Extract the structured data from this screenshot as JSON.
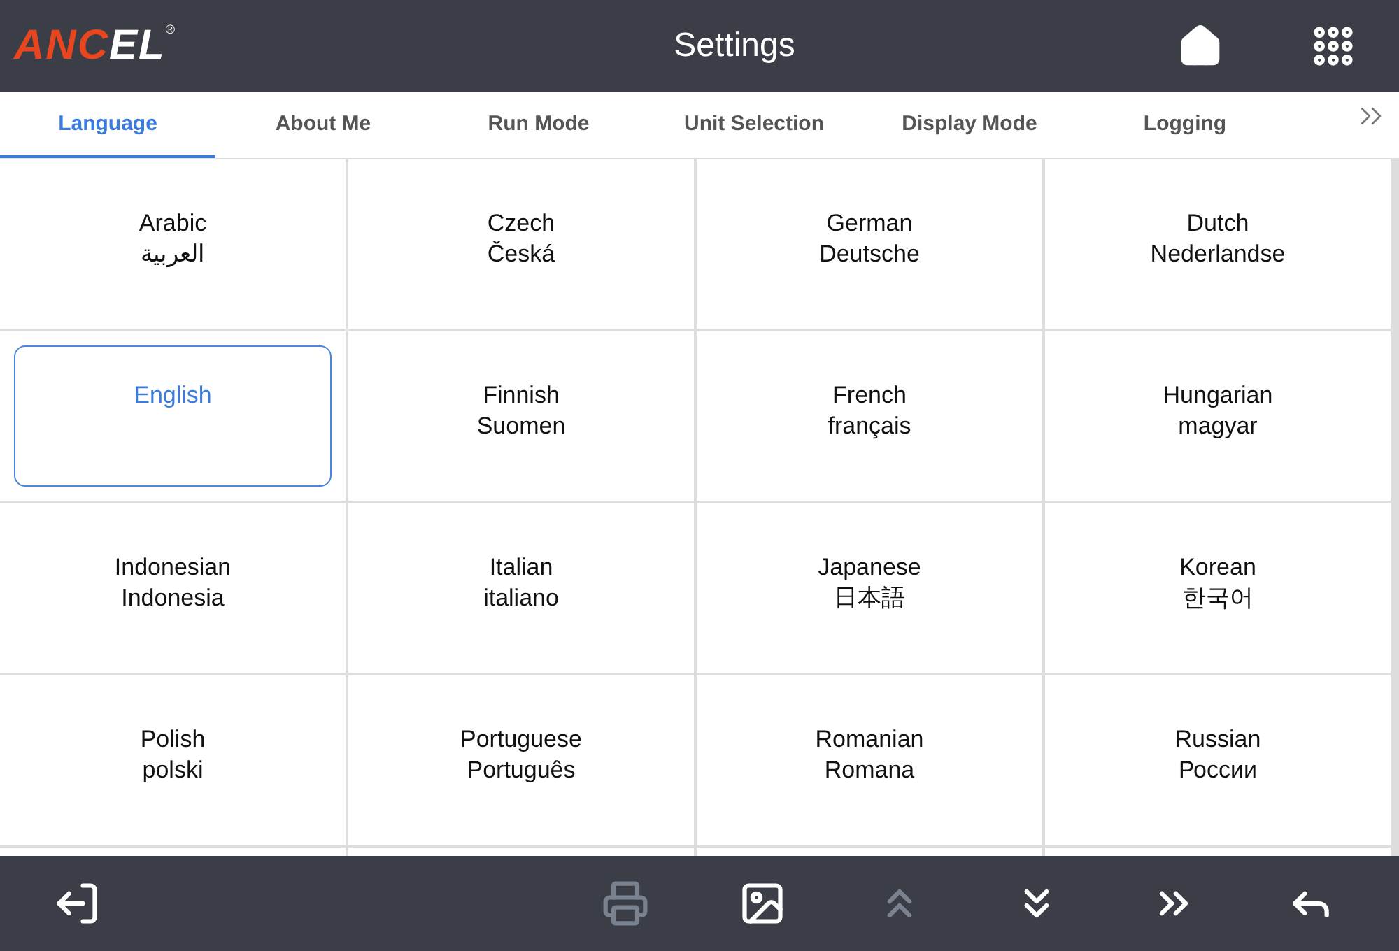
{
  "header": {
    "logo": {
      "primary": "ANC",
      "secondary": "EL",
      "mark": "®"
    },
    "title": "Settings"
  },
  "tabs": [
    {
      "label": "Language",
      "selected": true
    },
    {
      "label": "About Me",
      "selected": false
    },
    {
      "label": "Run Mode",
      "selected": false
    },
    {
      "label": "Unit Selection",
      "selected": false
    },
    {
      "label": "Display Mode",
      "selected": false
    },
    {
      "label": "Logging",
      "selected": false
    }
  ],
  "languages": [
    {
      "name": "Arabic",
      "native": "العربية",
      "selected": false
    },
    {
      "name": "Czech",
      "native": "Česká",
      "selected": false
    },
    {
      "name": "German",
      "native": "Deutsche",
      "selected": false
    },
    {
      "name": "Dutch",
      "native": "Nederlandse",
      "selected": false
    },
    {
      "name": "English",
      "selected": true
    },
    {
      "name": "Finnish",
      "native": "Suomen",
      "selected": false
    },
    {
      "name": "French",
      "native": "français",
      "selected": false
    },
    {
      "name": "Hungarian",
      "native": "magyar",
      "selected": false
    },
    {
      "name": "Indonesian",
      "native": "Indonesia",
      "selected": false
    },
    {
      "name": "Italian",
      "native": "italiano",
      "selected": false
    },
    {
      "name": "Japanese",
      "native": "日本語",
      "selected": false
    },
    {
      "name": "Korean",
      "native": "한국어",
      "selected": false
    },
    {
      "name": "Polish",
      "native": "polski",
      "selected": false
    },
    {
      "name": "Portuguese",
      "native": "Português",
      "selected": false
    },
    {
      "name": "Romanian",
      "native": "Romana",
      "selected": false
    },
    {
      "name": "Russian",
      "native": "России",
      "selected": false
    }
  ],
  "toolbar": [
    {
      "disabled": false
    },
    {
      "disabled": true
    },
    {
      "disabled": false
    },
    {
      "disabled": true
    },
    {
      "disabled": false
    },
    {
      "disabled": false
    },
    {
      "disabled": false
    }
  ]
}
